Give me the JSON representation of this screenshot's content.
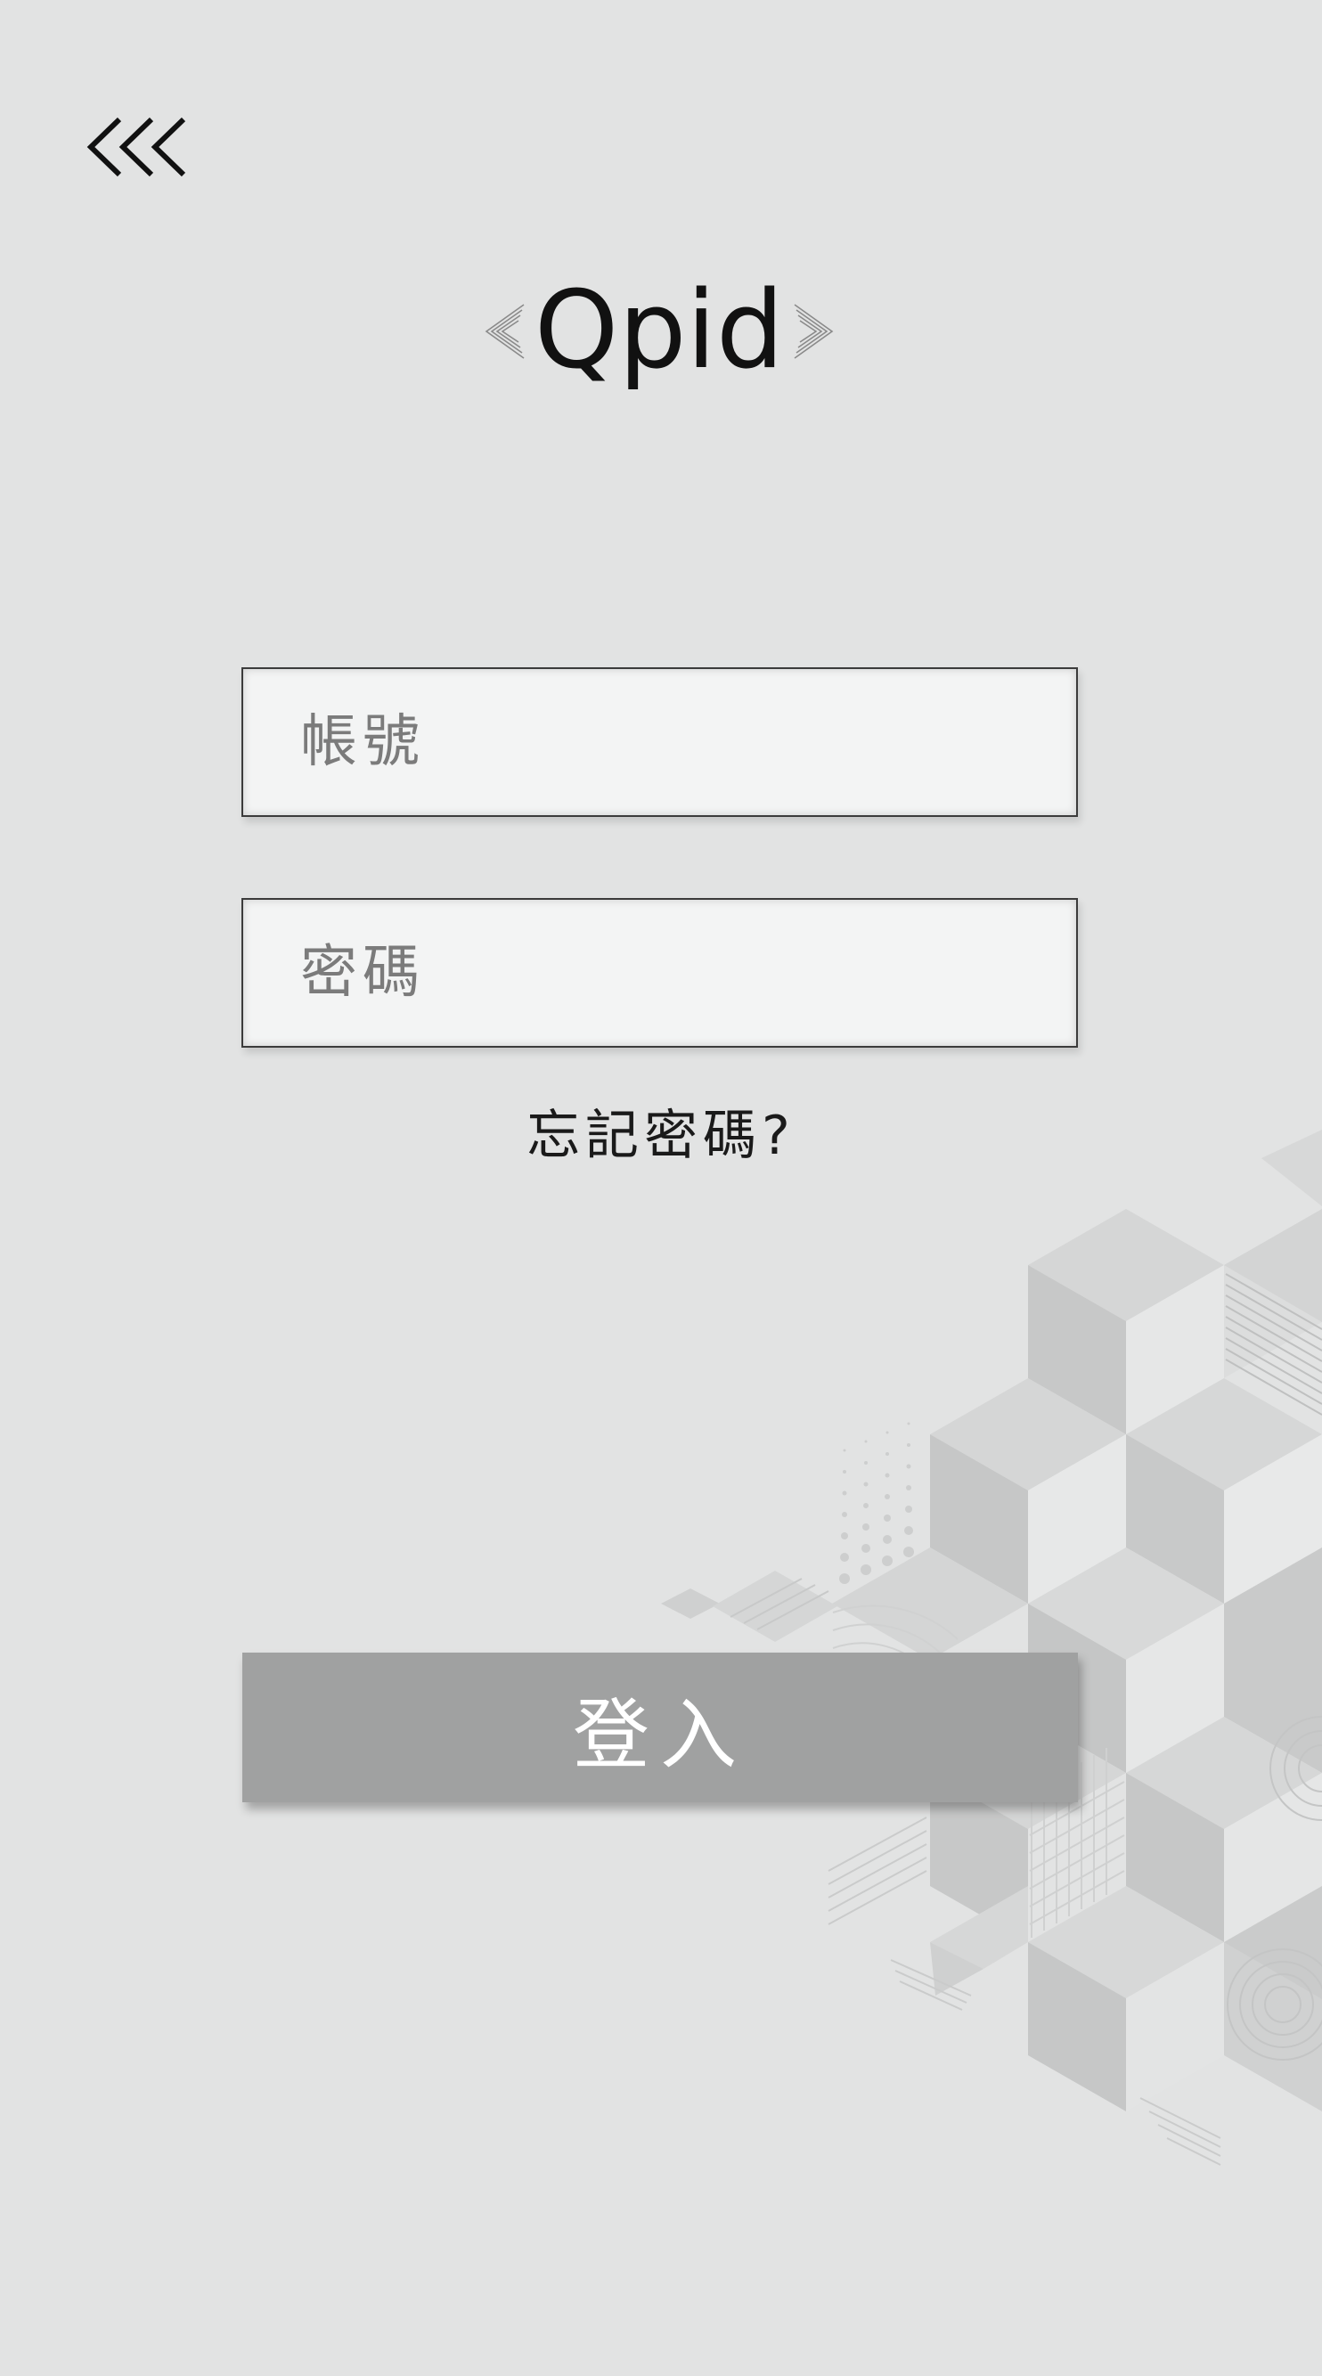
{
  "header": {
    "back_icon": "triple-chevron-left-icon",
    "logo_text": "Qpid"
  },
  "form": {
    "account_placeholder": "帳號",
    "password_placeholder": "密碼",
    "forgot_label": "忘記密碼?",
    "login_label": "登入"
  },
  "colors": {
    "background": "#e2e3e3",
    "field_fill": "#f3f4f4",
    "button_fill": "#a0a1a1",
    "button_text": "#ffffff"
  }
}
